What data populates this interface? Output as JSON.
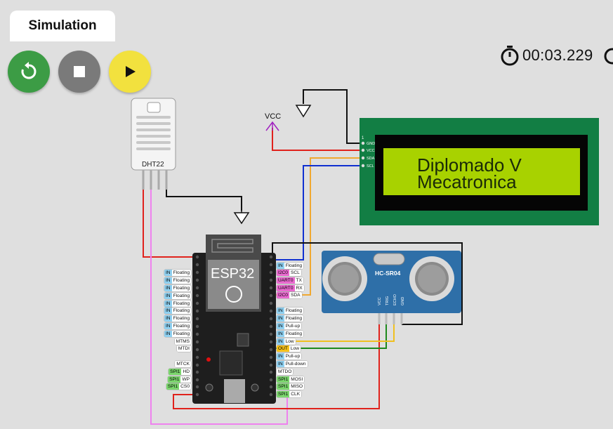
{
  "tab": {
    "label": "Simulation"
  },
  "controls": {
    "restart": {
      "color": "#3c9c45"
    },
    "stop": {
      "color": "#7a7a7a"
    },
    "play": {
      "color": "#f2e13e"
    }
  },
  "timer": {
    "value": "00:03.229"
  },
  "labels": {
    "vcc": "VCC",
    "dht": "DHT22",
    "esp": "ESP32",
    "sonar": "HC-SR04",
    "sonar_pins": [
      "VCC",
      "TRIG",
      "ECHO",
      "GND"
    ],
    "lcd_pins": [
      "GND",
      "VCC",
      "SDA",
      "SCL"
    ],
    "lcd_pin1": "1"
  },
  "lcd": {
    "line1": "Diplomado V",
    "line2": "Mecatronica",
    "background": "#a8d200",
    "board": "#127e44"
  },
  "pins_left": [
    {
      "k": "IN",
      "v": "Floating"
    },
    {
      "k": "IN",
      "v": "Floating"
    },
    {
      "k": "IN",
      "v": "Floating"
    },
    {
      "k": "IN",
      "v": "Floating"
    },
    {
      "k": "IN",
      "v": "Floating"
    },
    {
      "k": "IN",
      "v": "Floating"
    },
    {
      "k": "IN",
      "v": "Floating"
    },
    {
      "k": "IN",
      "v": "Floating"
    },
    {
      "k": "IN",
      "v": "Floating"
    },
    {
      "k": "",
      "v": "MTMS"
    },
    {
      "k": "",
      "v": "MTDI"
    },
    {
      "k": "",
      "v": "MTCK"
    },
    {
      "k": "SPI1",
      "v": "HD"
    },
    {
      "k": "SPI1",
      "v": "WP"
    },
    {
      "k": "SPI1",
      "v": "CS0"
    }
  ],
  "pins_right": [
    {
      "k": "IN",
      "v": "Floating"
    },
    {
      "k": "I2C0",
      "v": "SCL"
    },
    {
      "k": "UART0",
      "v": "TX"
    },
    {
      "k": "UART0",
      "v": "RX"
    },
    {
      "k": "I2C0",
      "v": "SDA"
    },
    {
      "k": "IN",
      "v": "Floating"
    },
    {
      "k": "IN",
      "v": "Floating"
    },
    {
      "k": "IN",
      "v": "Pull-up"
    },
    {
      "k": "IN",
      "v": "Floating"
    },
    {
      "k": "IN",
      "v": "Low"
    },
    {
      "k": "OUT",
      "v": "Low"
    },
    {
      "k": "IN",
      "v": "Pull-up"
    },
    {
      "k": "IN",
      "v": "Pull-down"
    },
    {
      "k": "",
      "v": "MTDO"
    },
    {
      "k": "SPI1",
      "v": "MOSI"
    },
    {
      "k": "SPI1",
      "v": "MISO"
    },
    {
      "k": "SPI1",
      "v": "CLK"
    }
  ]
}
